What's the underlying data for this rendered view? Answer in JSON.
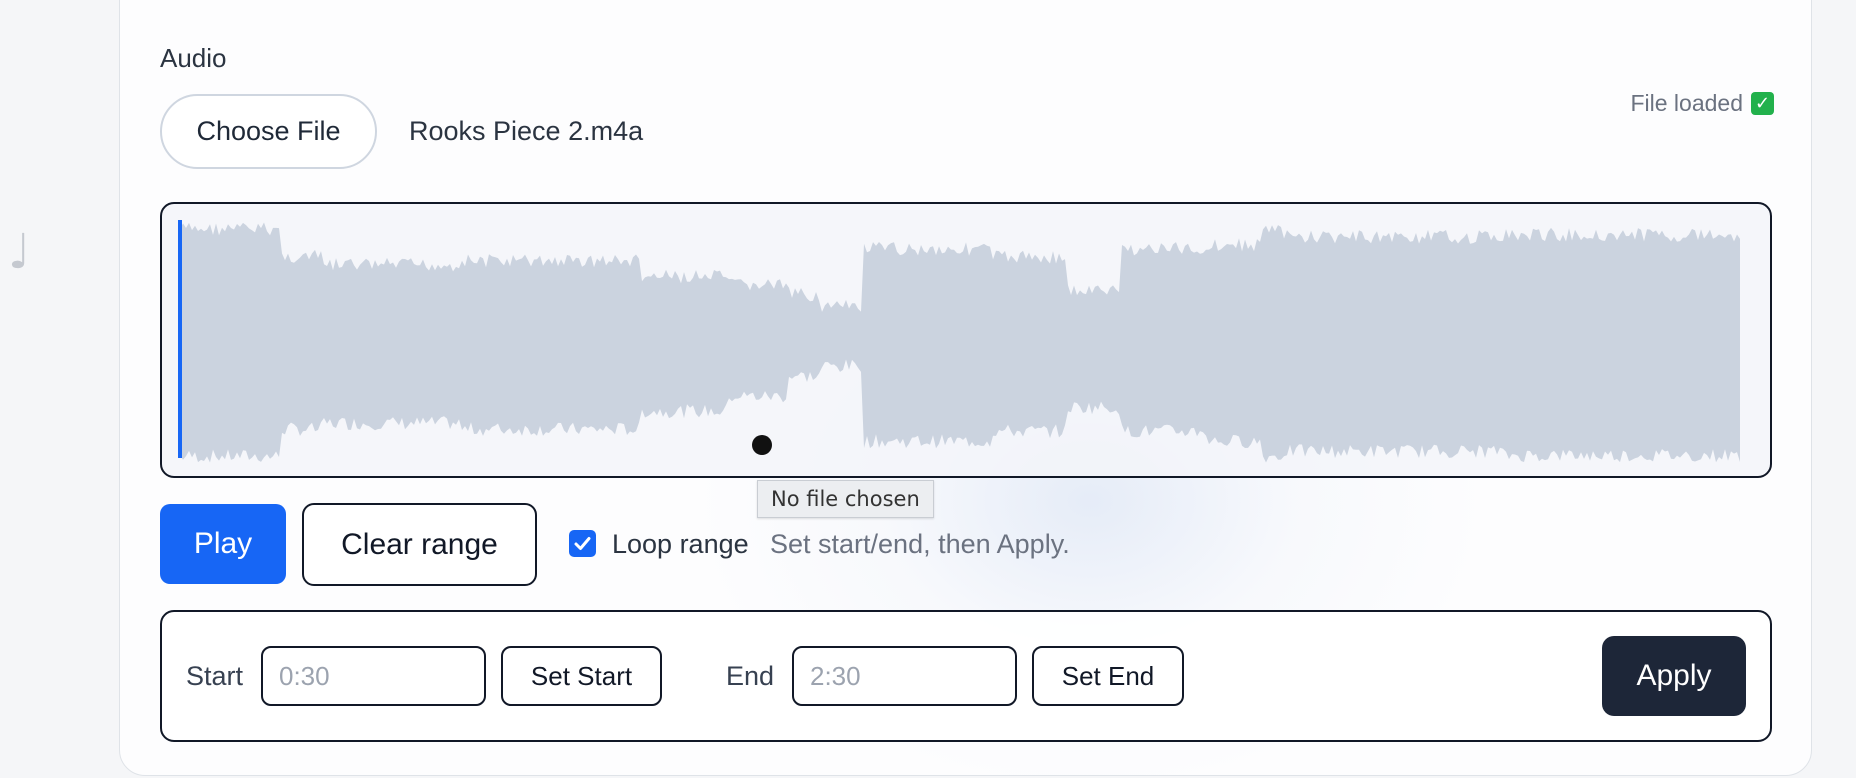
{
  "audio": {
    "section_label": "Audio",
    "choose_file_label": "Choose File",
    "file_name": "Rooks Piece 2.m4a",
    "status_text": "File loaded",
    "status_icon": "check-mark-icon",
    "decorative_glyph": "♩"
  },
  "waveform": {
    "playhead_fraction": 0.01,
    "waveform_color": "#cbd3df",
    "playhead_color": "#1766f5",
    "tooltip": "No file chosen"
  },
  "controls": {
    "play_label": "Play",
    "clear_range_label": "Clear range",
    "loop_range_label": "Loop range",
    "loop_range_checked": true,
    "hint": "Set start/end, then Apply."
  },
  "range": {
    "start_label": "Start",
    "start_value": "",
    "start_placeholder": "0:30",
    "set_start_label": "Set Start",
    "end_label": "End",
    "end_value": "",
    "end_placeholder": "2:30",
    "set_end_label": "Set End",
    "apply_label": "Apply"
  },
  "colors": {
    "accent": "#1766f5",
    "dark_button": "#1d2638",
    "check_green": "#22b14c"
  }
}
